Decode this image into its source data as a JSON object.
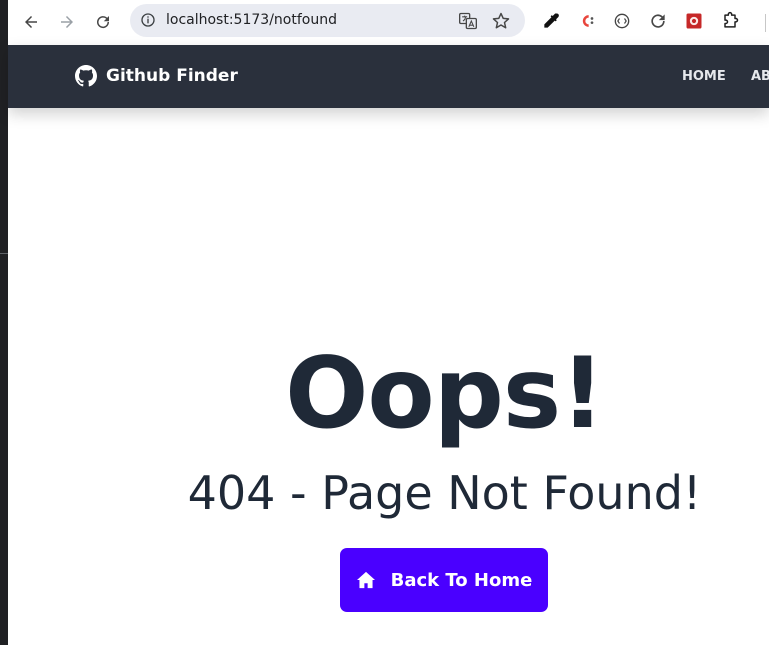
{
  "browser": {
    "url": "localhost:5173/notfound",
    "icons": [
      "back-icon",
      "forward-icon",
      "reload-icon",
      "info-icon",
      "translate-icon",
      "star-icon",
      "eyedropper-icon",
      "extension-c-icon",
      "extension-circle-icon",
      "refresh-extension-icon",
      "extension-red-icon",
      "puzzle-icon"
    ]
  },
  "navbar": {
    "brand": "Github Finder",
    "links": [
      "HOME",
      "AB"
    ]
  },
  "main": {
    "heading": "Oops!",
    "subheading": "404 - Page Not Found!",
    "button_label": "Back To Home"
  },
  "colors": {
    "navbar_bg": "#2a303c",
    "text_dark": "#1f2937",
    "button_bg": "#4a00ff"
  }
}
